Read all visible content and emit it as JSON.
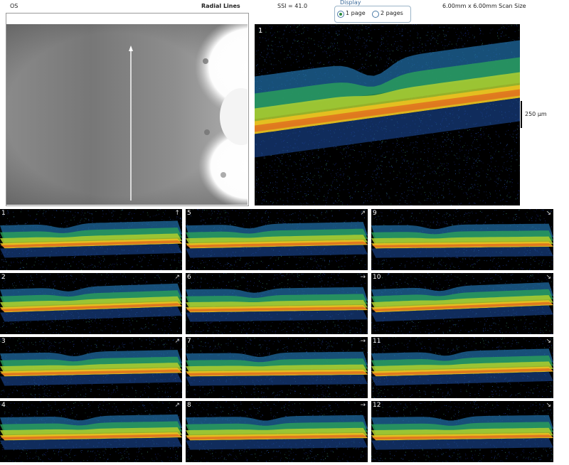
{
  "header": {
    "eye": "OS",
    "protocol": "Radial Lines",
    "ssi": "SSI = 41.0",
    "scan_size": "6.00mm x 6.00mm Scan Size"
  },
  "display": {
    "legend": "Display",
    "options": [
      {
        "label": "1 page",
        "selected": true
      },
      {
        "label": "2 pages",
        "selected": false
      }
    ]
  },
  "main_scan": {
    "number": "1"
  },
  "scale_label": "250 µm",
  "scans": [
    {
      "number": "1",
      "arrow": "↑"
    },
    {
      "number": "2",
      "arrow": "↗"
    },
    {
      "number": "3",
      "arrow": "↗"
    },
    {
      "number": "4",
      "arrow": "↗"
    },
    {
      "number": "5",
      "arrow": "↗"
    },
    {
      "number": "6",
      "arrow": "→"
    },
    {
      "number": "7",
      "arrow": "→"
    },
    {
      "number": "8",
      "arrow": "→"
    },
    {
      "number": "9",
      "arrow": "↘"
    },
    {
      "number": "10",
      "arrow": "↘"
    },
    {
      "number": "11",
      "arrow": "↘"
    },
    {
      "number": "12",
      "arrow": "↘"
    }
  ]
}
